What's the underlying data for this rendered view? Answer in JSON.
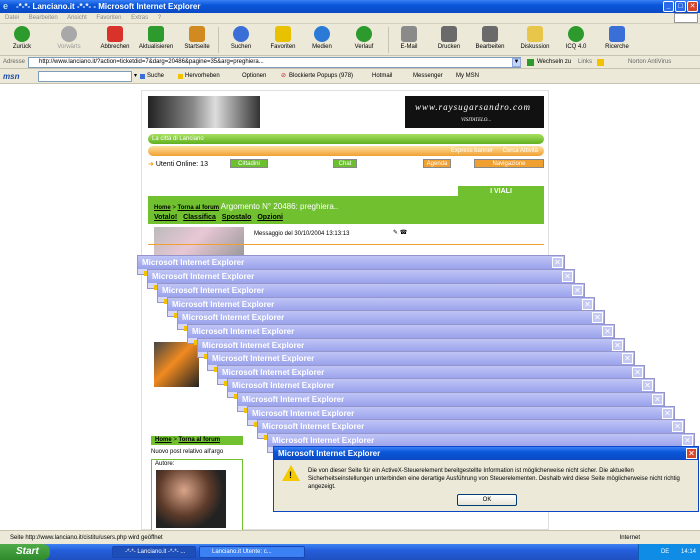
{
  "window": {
    "title": "-*-*- Lanciano.it -*-*- - Microsoft Internet Explorer",
    "min_glyph": "_",
    "max_glyph": "□",
    "close_glyph": "✕"
  },
  "menu": [
    "Datei",
    "Bearbeiten",
    "Ansicht",
    "Favoriten",
    "Extras",
    "?"
  ],
  "toolbar": [
    {
      "label": "Zurück",
      "icon": "back-arrow-icon",
      "color": "#2c9a2c"
    },
    {
      "label": "Vorwärts",
      "icon": "forward-arrow-icon",
      "color": "#a8a8a8"
    },
    {
      "label": "Abbrechen",
      "icon": "stop-icon",
      "color": "#d9322a"
    },
    {
      "label": "Aktualisieren",
      "icon": "refresh-icon",
      "color": "#2c9a2c"
    },
    {
      "label": "Startseite",
      "icon": "home-icon",
      "color": "#d08a20"
    },
    {
      "label": "Suchen",
      "icon": "search-icon",
      "color": "#3a6fd8"
    },
    {
      "label": "Favoriten",
      "icon": "favorites-star-icon",
      "color": "#e8c200"
    },
    {
      "label": "Medien",
      "icon": "media-icon",
      "color": "#2a7ad6"
    },
    {
      "label": "Verlauf",
      "icon": "history-icon",
      "color": "#2c9a2c"
    },
    {
      "label": "E-Mail",
      "icon": "mail-icon",
      "color": "#8a8a8a"
    },
    {
      "label": "Drucken",
      "icon": "print-icon",
      "color": "#6a6a6a"
    },
    {
      "label": "Bearbeiten",
      "icon": "edit-icon",
      "color": "#6a6a6a"
    },
    {
      "label": "Diskussion",
      "icon": "discussion-icon",
      "color": "#e8c64a"
    },
    {
      "label": "ICQ 4.0",
      "icon": "icq-flower-icon",
      "color": "#2c9a2c"
    },
    {
      "label": "Ricerche",
      "icon": "search-binoculars-icon",
      "color": "#3a6fd8"
    }
  ],
  "address": {
    "label": "Adresse",
    "url": "http://www.lanciano.it/?action=ticketdid=7&darg=20486&pagine=35&arg=preghiera...",
    "go_label": "Wechseln zu",
    "links_label": "Links",
    "norton_label": "Norton AntiVirus"
  },
  "msn_toolbar": {
    "logo": "msn",
    "search_label": "Suche",
    "highlight_label": "Hervorheben",
    "options_label": "Optionen",
    "popup_label": "Blockierte Popups (978)",
    "hotmail_label": "Hotmail",
    "messenger_label": "Messenger",
    "mymsn_label": "My MSN"
  },
  "site": {
    "banner_title": "www.raysugarsandro.com",
    "banner_sub": "VISITATELO...",
    "city_bar": "La città di Lanciano",
    "express_banner": "Express banner",
    "cerca": "Cerca Attività",
    "online": "Utenti Online: 13",
    "pills": [
      {
        "label": "Cittadini",
        "color": "#6cc030"
      },
      {
        "label": "Chat",
        "color": "#6cc030"
      },
      {
        "label": "Agenda",
        "color": "#f0a030"
      },
      {
        "label": "Navigazione",
        "color": "#f0a030"
      }
    ],
    "viali_tab": "I VIALI",
    "crumb_home": "Home",
    "crumb_forum": "Torna al forum",
    "argomento": "Argomento N° 20486: preghiera..",
    "links": [
      "Votalo!",
      "Classifica",
      "Spostalo",
      "Opzioni"
    ],
    "message_date": "Messaggio del 30/10/2004 13:13:13",
    "lower_crumb_home": "Home",
    "lower_crumb_forum": "Torna al forum",
    "lower_sub": "Nuovo post relativo all'argo",
    "autore": "Autore:"
  },
  "stacked_dialog": {
    "title": "Microsoft Internet Explorer",
    "close_glyph": "✕"
  },
  "main_dialog": {
    "title": "Microsoft Internet Explorer",
    "message": "Die von dieser Seite für ein ActiveX-Steuerelement bereitgestellte Information ist möglicherweise nicht sicher. Die aktuellen Sicherheitseinstellungen unterbinden eine derartige Ausführung von Steuerelementen. Deshalb wird diese Seite möglicherweise nicht richtig angezeigt.",
    "ok_label": "OK",
    "warn_mark": "!"
  },
  "status": {
    "text": "Seite http://www.lanciano.it/cistitu/users.php wird geöffnet",
    "zone": "Internet"
  },
  "taskbar": {
    "start": "Start",
    "tasks": [
      "-*-*- Lanciano.it -*-*- ...",
      "Lanciano.it Utente: c..."
    ],
    "lang": "DE",
    "clock": "14:14"
  }
}
